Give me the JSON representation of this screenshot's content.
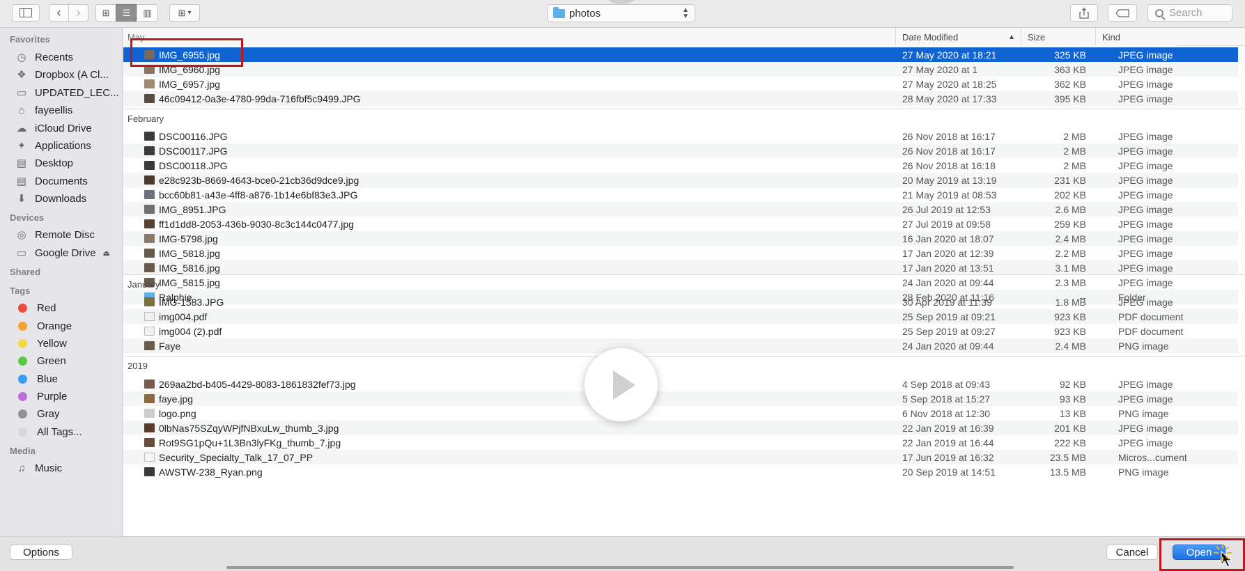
{
  "toolbar": {
    "path_folder": "photos",
    "search_placeholder": "Search"
  },
  "sidebar": {
    "favorites_header": "Favorites",
    "favorites": [
      {
        "label": "Recents",
        "icon": "recents-icon"
      },
      {
        "label": "Dropbox (A Cl...",
        "icon": "dropbox-icon"
      },
      {
        "label": "UPDATED_LEC...",
        "icon": "folder-icon"
      },
      {
        "label": "fayeellis",
        "icon": "home-icon"
      },
      {
        "label": "iCloud Drive",
        "icon": "cloud-icon"
      },
      {
        "label": "Applications",
        "icon": "applications-icon"
      },
      {
        "label": "Desktop",
        "icon": "desktop-icon"
      },
      {
        "label": "Documents",
        "icon": "documents-icon"
      },
      {
        "label": "Downloads",
        "icon": "downloads-icon"
      }
    ],
    "devices_header": "Devices",
    "devices": [
      {
        "label": "Remote Disc",
        "icon": "disc-icon"
      },
      {
        "label": "Google Drive",
        "icon": "drive-icon"
      }
    ],
    "shared_header": "Shared",
    "tags_header": "Tags",
    "tags": [
      {
        "label": "Red",
        "color": "#ee4b41"
      },
      {
        "label": "Orange",
        "color": "#f5a135"
      },
      {
        "label": "Yellow",
        "color": "#f7d748"
      },
      {
        "label": "Green",
        "color": "#5cc63f"
      },
      {
        "label": "Blue",
        "color": "#3b9bf2"
      },
      {
        "label": "Purple",
        "color": "#bb6ed8"
      },
      {
        "label": "Gray",
        "color": "#929296"
      },
      {
        "label": "All Tags...",
        "color": "#d9d9dc"
      }
    ],
    "media_header": "Media",
    "media": [
      {
        "label": "Music",
        "icon": "music-icon"
      }
    ]
  },
  "columns": {
    "name_group": "May",
    "date": "Date Modified",
    "size": "Size",
    "kind": "Kind"
  },
  "groups": [
    {
      "label": "May",
      "rows": [
        {
          "name": "IMG_6955.jpg",
          "date": "27 May 2020 at 18:21",
          "size": "325 KB",
          "kind": "JPEG image",
          "thumb": "#7a6a5a"
        },
        {
          "name": "IMG_6960.jpg",
          "date": "27 May 2020 at 1",
          "size": "363 KB",
          "kind": "JPEG image",
          "thumb": "#8a7560"
        },
        {
          "name": "IMG_6957.jpg",
          "date": "27 May 2020 at 18:25",
          "size": "362 KB",
          "kind": "JPEG image",
          "thumb": "#a08a70"
        },
        {
          "name": "46c09412-0a3e-4780-99da-716fbf5c9499.JPG",
          "date": "28 May 2020 at 17:33",
          "size": "395 KB",
          "kind": "JPEG image",
          "thumb": "#5a4a40"
        }
      ]
    },
    {
      "label": "February",
      "rows": [
        {
          "name": "DSC00116.JPG",
          "date": "26 Nov 2018 at 16:17",
          "size": "2 MB",
          "kind": "JPEG image",
          "thumb": "#3a3a3a"
        },
        {
          "name": "DSC00117.JPG",
          "date": "26 Nov 2018 at 16:17",
          "size": "2 MB",
          "kind": "JPEG image",
          "thumb": "#3a3a3a"
        },
        {
          "name": "DSC00118.JPG",
          "date": "26 Nov 2018 at 16:18",
          "size": "2 MB",
          "kind": "JPEG image",
          "thumb": "#3a3a3a"
        },
        {
          "name": "e28c923b-8669-4643-bce0-21cb36d9dce9.jpg",
          "date": "20 May 2019 at 13:19",
          "size": "231 KB",
          "kind": "JPEG image",
          "thumb": "#4a3a30"
        },
        {
          "name": "bcc60b81-a43e-4ff8-a876-1b14e6bf83e3.JPG",
          "date": "21 May 2019 at 08:53",
          "size": "202 KB",
          "kind": "JPEG image",
          "thumb": "#6a7080"
        },
        {
          "name": "IMG_8951.JPG",
          "date": "26 Jul 2019 at 12:53",
          "size": "2.6 MB",
          "kind": "JPEG image",
          "thumb": "#707070"
        },
        {
          "name": "ff1d1dd8-2053-436b-9030-8c3c144c0477.jpg",
          "date": "27 Jul 2019 at 09:58",
          "size": "259 KB",
          "kind": "JPEG image",
          "thumb": "#5a4030"
        },
        {
          "name": "IMG-5798.jpg",
          "date": "16 Jan 2020 at 18:07",
          "size": "2.4 MB",
          "kind": "JPEG image",
          "thumb": "#8a7a68"
        },
        {
          "name": "IMG_5818.jpg",
          "date": "17 Jan 2020 at 12:39",
          "size": "2.2 MB",
          "kind": "JPEG image",
          "thumb": "#6a5a4a"
        },
        {
          "name": "IMG_5816.jpg",
          "date": "17 Jan 2020 at 13:51",
          "size": "3.1 MB",
          "kind": "JPEG image",
          "thumb": "#6a5a4a"
        },
        {
          "name": "IMG_5815.jpg",
          "date": "24 Jan 2020 at 09:44",
          "size": "2.3 MB",
          "kind": "JPEG image",
          "thumb": "#6a5a4a"
        },
        {
          "name": "Ralphie",
          "date": "28 Feb 2020 at 11:16",
          "size": "--",
          "kind": "Folder",
          "thumb": "#5fb0e8"
        }
      ]
    },
    {
      "label": "January",
      "rows": [
        {
          "name": "IMG-1583.JPG",
          "date": "30 Apr 2019 at 11:39",
          "size": "1.8 MB",
          "kind": "JPEG image",
          "thumb": "#7a7040"
        },
        {
          "name": "img004.pdf",
          "date": "25 Sep 2019 at 09:21",
          "size": "923 KB",
          "kind": "PDF document",
          "thumb": "#f0f0f0"
        },
        {
          "name": "img004 (2).pdf",
          "date": "25 Sep 2019 at 09:27",
          "size": "923 KB",
          "kind": "PDF document",
          "thumb": "#f0f0f0"
        },
        {
          "name": "Faye",
          "date": "24 Jan 2020 at 09:44",
          "size": "2.4 MB",
          "kind": "PNG image",
          "thumb": "#6a5a4a"
        }
      ]
    },
    {
      "label": "2019",
      "rows": [
        {
          "name": "269aa2bd-b405-4429-8083-1861832fef73.jpg",
          "date": "4 Sep 2018 at 09:43",
          "size": "92 KB",
          "kind": "JPEG image",
          "thumb": "#7a5a4a"
        },
        {
          "name": "faye.jpg",
          "date": "5 Sep 2018 at 15:27",
          "size": "93 KB",
          "kind": "JPEG image",
          "thumb": "#8a6a40"
        },
        {
          "name": "logo.png",
          "date": "6 Nov 2018 at 12:30",
          "size": "13 KB",
          "kind": "PNG image",
          "thumb": "#cccccc"
        },
        {
          "name": "0lbNas75SZqyWPjfNBxuLw_thumb_3.jpg",
          "date": "22 Jan 2019 at 16:39",
          "size": "201 KB",
          "kind": "JPEG image",
          "thumb": "#5a3a2a"
        },
        {
          "name": "Rot9SG1pQu+1L3Bn3lyFKg_thumb_7.jpg",
          "date": "22 Jan 2019 at 16:44",
          "size": "222 KB",
          "kind": "JPEG image",
          "thumb": "#6a4a3a"
        },
        {
          "name": "Security_Specialty_Talk_17_07_PP",
          "date": "17 Jun 2019 at 16:32",
          "size": "23.5 MB",
          "kind": "Micros...cument",
          "thumb": "#f5f5f5"
        },
        {
          "name": "AWSTW-238_Ryan.png",
          "date": "20 Sep 2019 at 14:51",
          "size": "13.5 MB",
          "kind": "PNG image",
          "thumb": "#3a3a3a"
        }
      ]
    }
  ],
  "footer": {
    "options_label": "Options",
    "cancel_label": "Cancel",
    "open_label": "Open"
  }
}
